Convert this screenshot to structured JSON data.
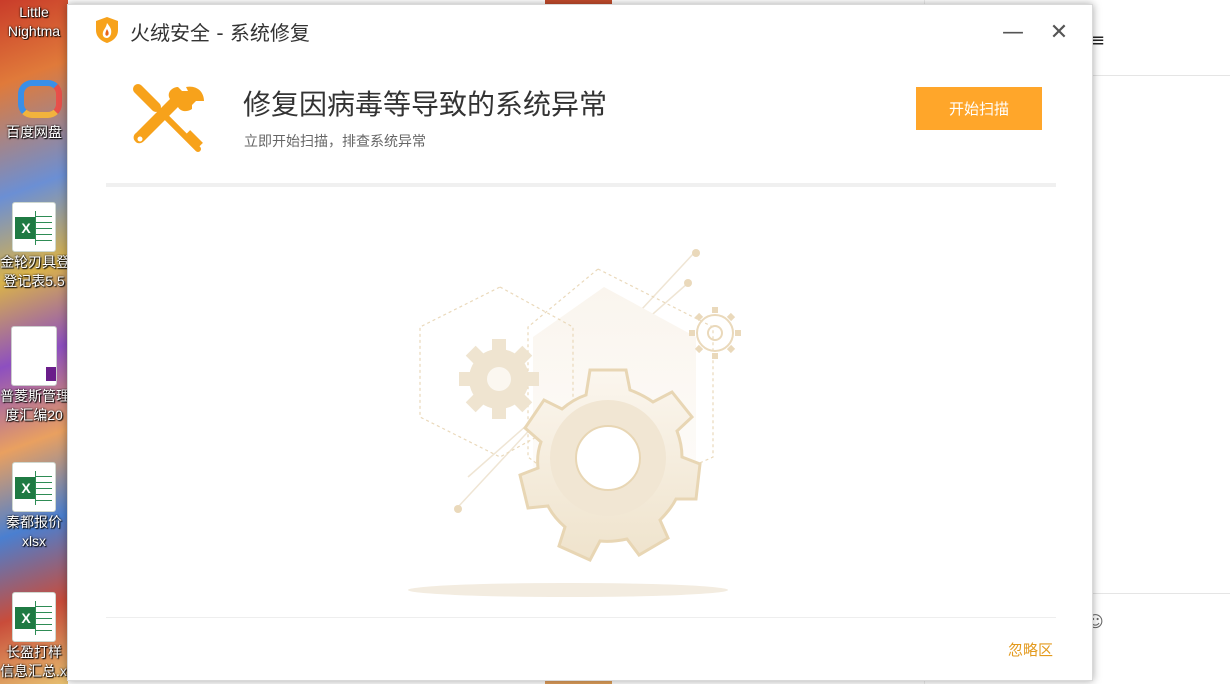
{
  "window": {
    "title": "火绒安全 - 系统修复",
    "minimize_glyph": "—",
    "close_glyph": "✕"
  },
  "header": {
    "icon": "wrench-screwdriver-icon",
    "title": "修复因病毒等导致的系统异常",
    "subtitle": "立即开始扫描，排查系统异常",
    "scan_button": "开始扫描"
  },
  "footer": {
    "ignore_link": "忽略区"
  },
  "colors": {
    "accent": "#ffa62a",
    "link": "#e39a1e",
    "illustration": "#e8d6b4"
  },
  "desktop": {
    "icons": [
      {
        "label_line1": "Little",
        "label_line2": "Nightma",
        "icon": "app-icon"
      },
      {
        "label_line1": "百度网盘",
        "label_line2": "",
        "icon": "cloud-icon"
      },
      {
        "label_line1": "金轮刃具登",
        "label_line2": "登记表5.5",
        "icon": "excel-icon"
      },
      {
        "label_line1": "普菱斯管理",
        "label_line2": "度汇编20",
        "icon": "document-icon"
      },
      {
        "label_line1": "秦都报价",
        "label_line2": "xlsx",
        "icon": "excel-icon"
      },
      {
        "label_line1": "长盈打样",
        "label_line2": "信息汇总.xlsx",
        "icon": "excel-icon"
      }
    ]
  },
  "background_app": {
    "menu_glyph": "≡",
    "emoji_glyph": "☺"
  }
}
